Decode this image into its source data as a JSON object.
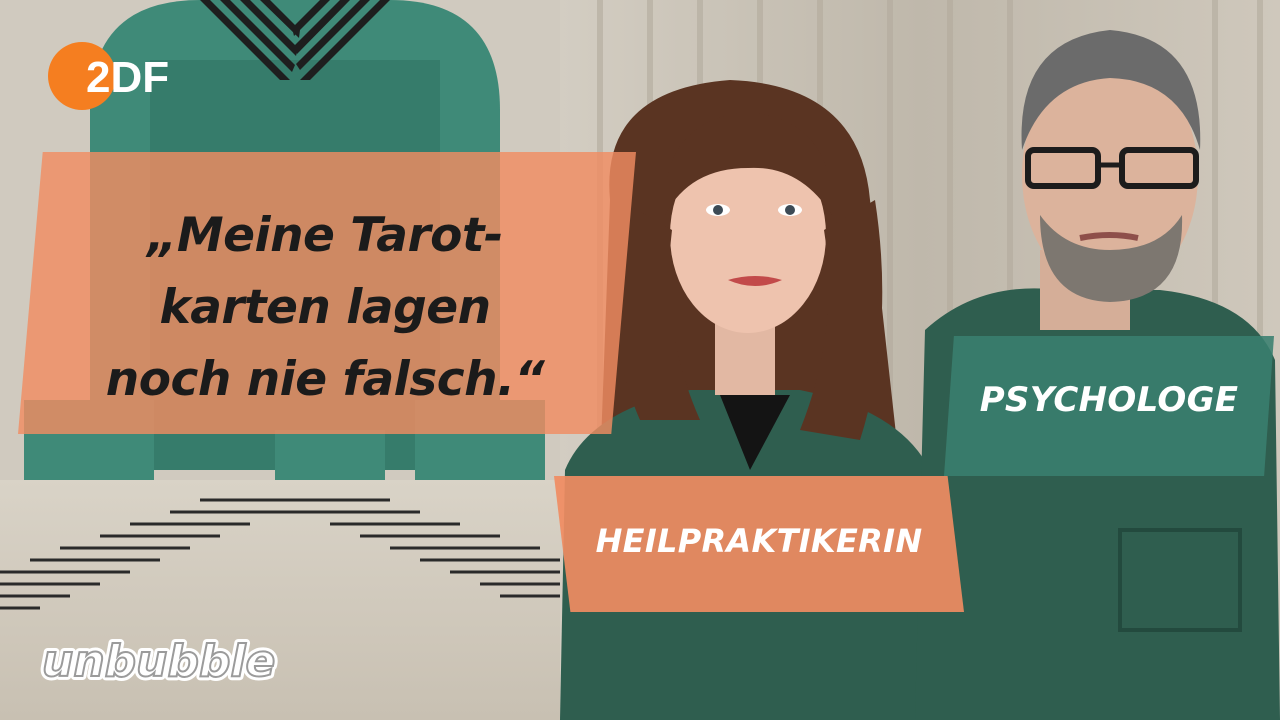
{
  "broadcaster": {
    "logo_text": "2DF"
  },
  "quote": {
    "lines": [
      "„Meine Tarot-",
      "karten lagen",
      "noch nie falsch.“"
    ]
  },
  "labels": {
    "left_person": "HEILPRAKTIKERIN",
    "right_person": "PSYCHOLOGE"
  },
  "show": {
    "logo_text": "unbubble"
  },
  "colors": {
    "accent_orange": "#f08c62",
    "accent_teal": "#3a8070",
    "zdf_orange": "#f57e20",
    "text_dark": "#1b1b1b",
    "text_light": "#ffffff"
  }
}
